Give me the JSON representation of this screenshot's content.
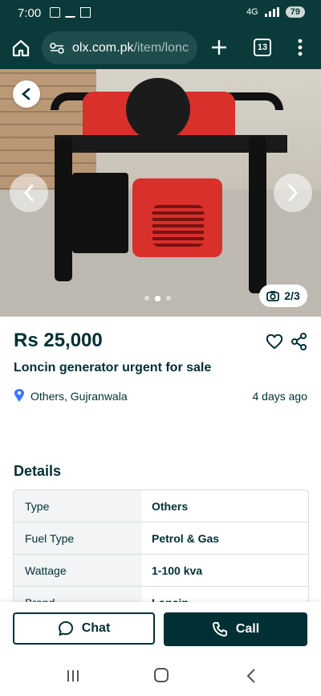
{
  "status_bar": {
    "time": "7:00",
    "network": "4G",
    "battery": "79"
  },
  "browser": {
    "url_domain": "olx.com.pk",
    "url_path": "/item/lonc",
    "tab_count": "13"
  },
  "gallery": {
    "counter": "2/3",
    "current": 2,
    "total": 3
  },
  "listing": {
    "price": "Rs 25,000",
    "title": "Loncin generator urgent for sale",
    "location": "Others, Gujranwala",
    "posted": "4 days ago"
  },
  "details": {
    "heading": "Details",
    "rows": [
      {
        "key": "Type",
        "value": "Others"
      },
      {
        "key": "Fuel Type",
        "value": "Petrol & Gas"
      },
      {
        "key": "Wattage",
        "value": "1-100 kva"
      },
      {
        "key": "Brand",
        "value": "Loncin"
      }
    ]
  },
  "actions": {
    "chat_label": "Chat",
    "call_label": "Call"
  },
  "colors": {
    "brand_dark": "#002f34",
    "browser_bar": "#0b3a3a"
  },
  "icons": [
    "home-icon",
    "site-settings-icon",
    "plus-icon",
    "tabs-icon",
    "menu-icon",
    "back-arrow-icon",
    "chevron-left-icon",
    "chevron-right-icon",
    "camera-icon",
    "heart-icon",
    "share-icon",
    "location-pin-icon",
    "chat-icon",
    "phone-icon"
  ]
}
